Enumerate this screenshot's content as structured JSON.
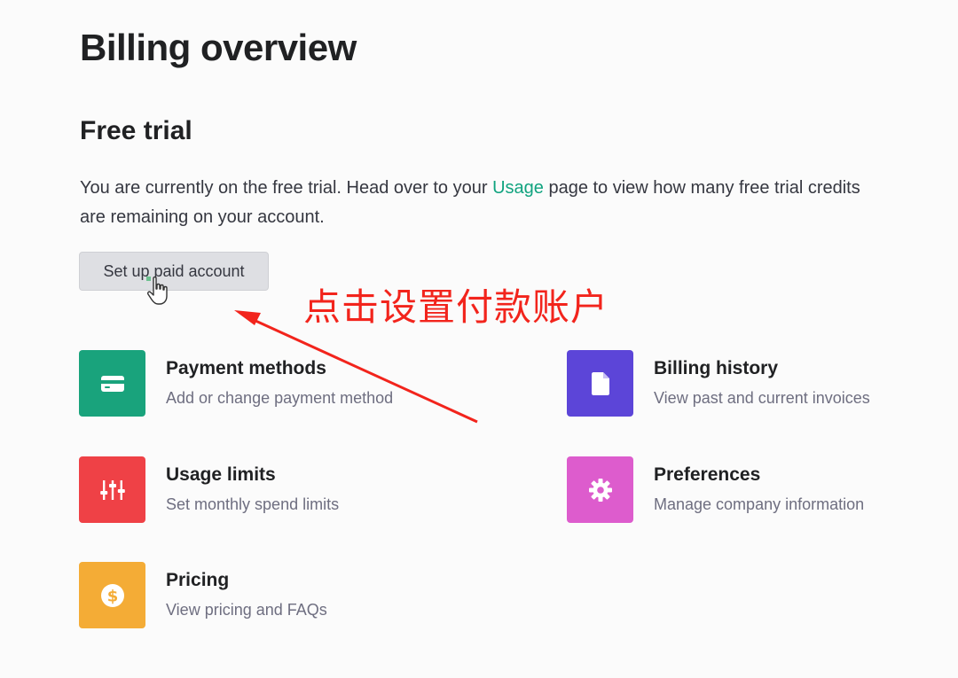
{
  "page": {
    "title": "Billing overview"
  },
  "free_trial": {
    "title": "Free trial",
    "text_before": "You are currently on the free trial. Head over to your",
    "link": "Usage",
    "text_after": "page to view how many free trial credits are remaining on your account.",
    "button_label": "Set up paid account"
  },
  "annotation": {
    "text": "点击设置付款账户",
    "color": "#f2241c"
  },
  "cards": [
    {
      "title": "Payment methods",
      "description": "Add or change payment method",
      "icon": "credit-card-icon",
      "color": "#19a37c"
    },
    {
      "title": "Billing history",
      "description": "View past and current invoices",
      "icon": "document-icon",
      "color": "#5c45d8"
    },
    {
      "title": "Usage limits",
      "description": "Set monthly spend limits",
      "icon": "sliders-icon",
      "color": "#ef4146"
    },
    {
      "title": "Preferences",
      "description": "Manage company information",
      "icon": "gear-icon",
      "color": "#dd5ccd"
    },
    {
      "title": "Pricing",
      "description": "View pricing and FAQs",
      "icon": "dollar-coin-icon",
      "color": "#f4ac36"
    }
  ]
}
